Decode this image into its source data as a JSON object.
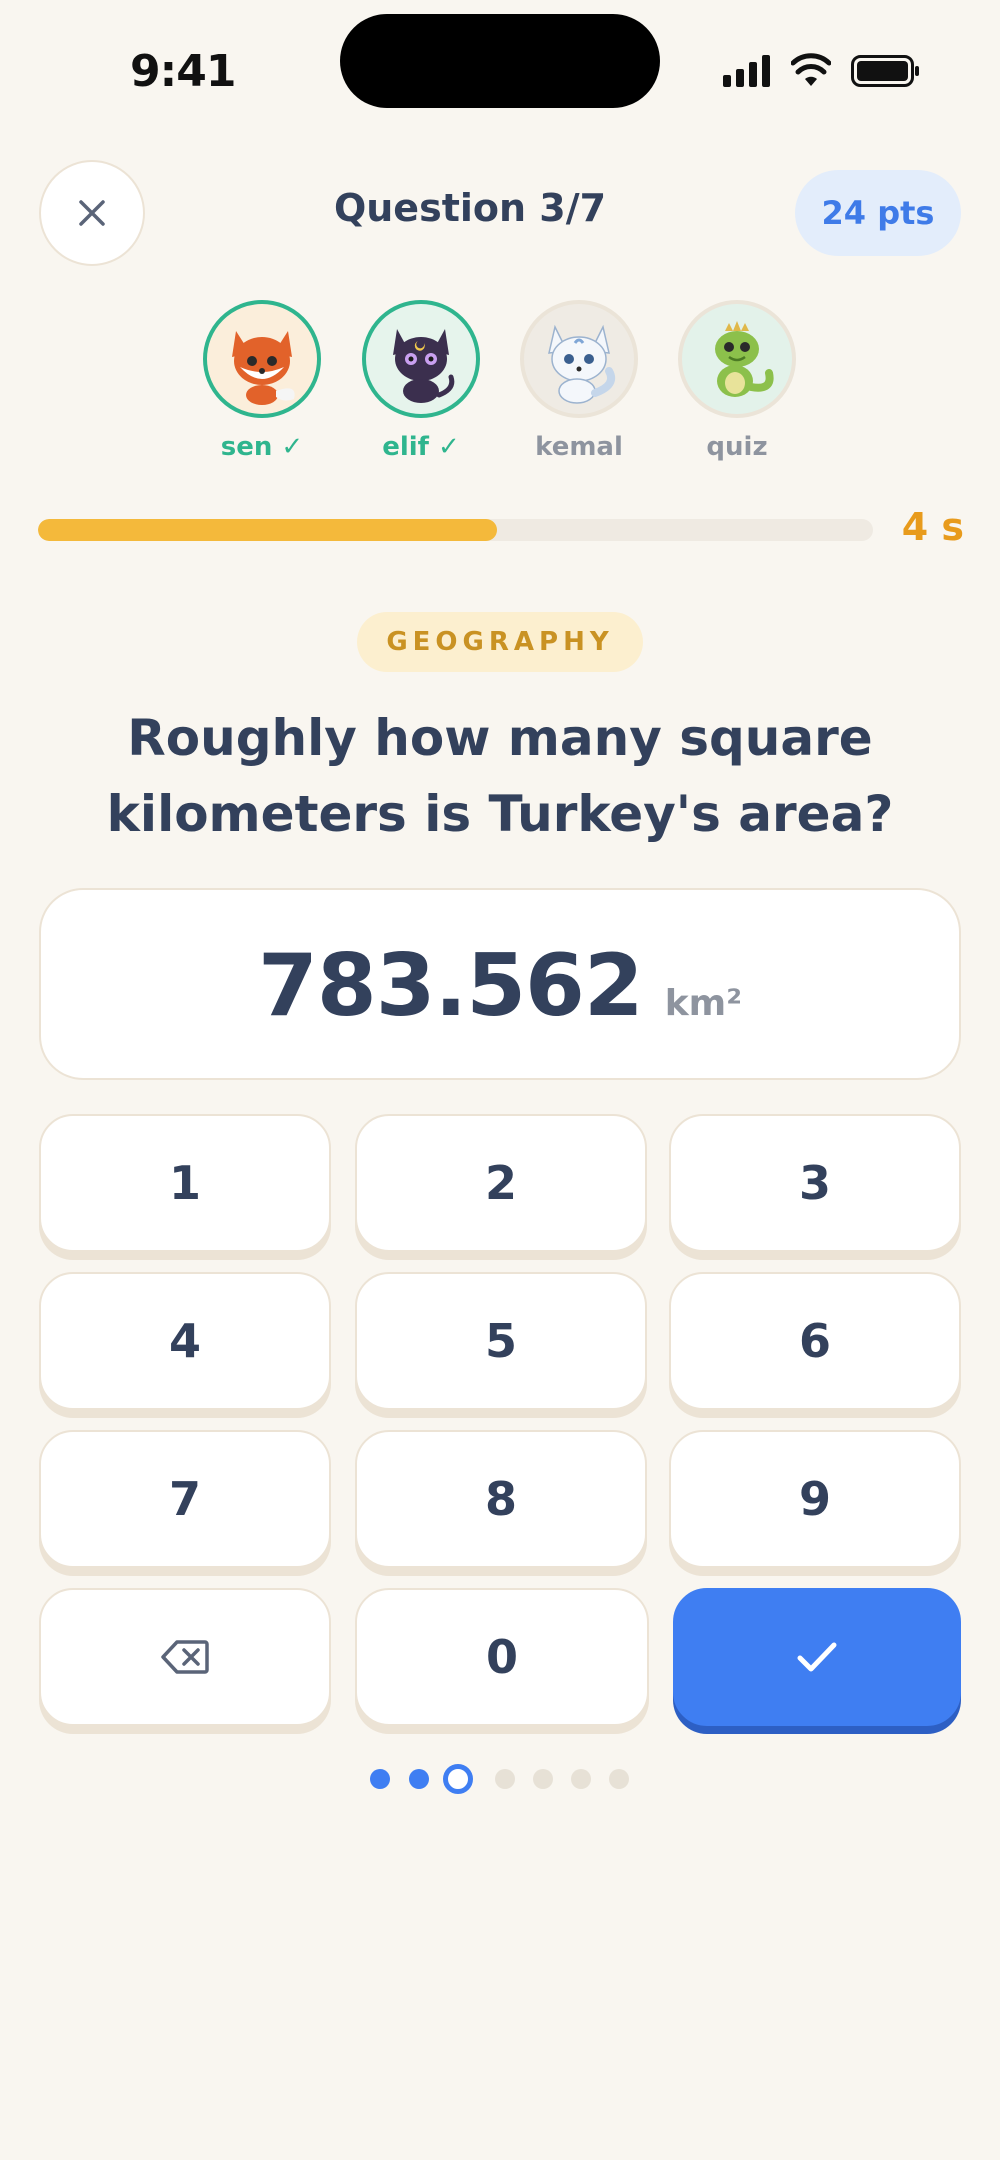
{
  "status_bar": {
    "time": "9:41"
  },
  "header": {
    "close_icon": "close-icon",
    "title": "Question 3/7",
    "points": "24 pts"
  },
  "players": [
    {
      "name": "sen ✓",
      "avatar": "fox-avatar",
      "answered": true,
      "ring_color": "#2fb58e",
      "bg_color": "#fbeedb"
    },
    {
      "name": "elif ✓",
      "avatar": "black-cat-avatar",
      "answered": true,
      "ring_color": "#2fb58e",
      "bg_color": "#e6f4ec"
    },
    {
      "name": "kemal",
      "avatar": "white-wolf-avatar",
      "answered": false,
      "ring_color": "#ebe4d8",
      "bg_color": "#efebe4"
    },
    {
      "name": "quiz",
      "avatar": "green-dragon-avatar",
      "answered": false,
      "ring_color": "#ebe4d8",
      "bg_color": "#e3f2ea"
    }
  ],
  "timer": {
    "text": "4 s",
    "remaining_fraction": 0.55,
    "color": "#f4b93b"
  },
  "category": "GEOGRAPHY",
  "question": "Roughly how many square kilometers is Turkey's area?",
  "answer": {
    "value": "783.562",
    "unit": "km²"
  },
  "keypad": {
    "keys": [
      "1",
      "2",
      "3",
      "4",
      "5",
      "6",
      "7",
      "8",
      "9",
      "0"
    ],
    "backspace_icon": "backspace-icon",
    "submit_icon": "checkmark-icon"
  },
  "progress": {
    "total": 7,
    "current": 3,
    "states": [
      "done",
      "done",
      "current",
      "pending",
      "pending",
      "pending",
      "pending"
    ]
  },
  "colors": {
    "accent": "#3f7ef2",
    "answered": "#2fb58e",
    "timer": "#e89b1c",
    "background": "#f9f6f0"
  }
}
